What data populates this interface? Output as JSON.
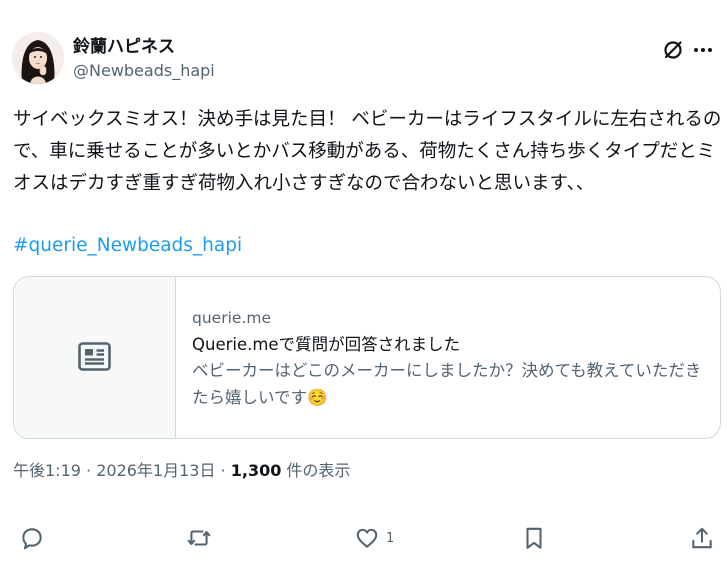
{
  "author": {
    "display_name": "鈴蘭ハピネス",
    "handle": "@Newbeads_hapi"
  },
  "tweet": {
    "text": "サイベックスミオス！決め手は見た目！ ベビーカーはライフスタイルに左右されるので、車に乗せることが多いとかバス移動がある、荷物たくさん持ち歩くタイプだとミオスはデカすぎ重すぎ荷物入れ小さすぎなので合わないと思います、、",
    "hashtag": "#querie_Newbeads_hapi"
  },
  "card": {
    "domain": "querie.me",
    "title": "Querie.meで質問が回答されました",
    "description": "ベビーカーはどこのメーカーにしましたか？決めても教えていただきたら嬉しいです",
    "emoji": "☺️"
  },
  "meta": {
    "time": "午後1:19",
    "separator": " · ",
    "date": "2026年1月13日",
    "views_count": "1,300",
    "views_label": " 件の表示"
  },
  "actions": {
    "like_count": "1"
  },
  "colors": {
    "link": "#1d9bf0",
    "secondary_text": "#536471",
    "border": "#cfd9de"
  }
}
